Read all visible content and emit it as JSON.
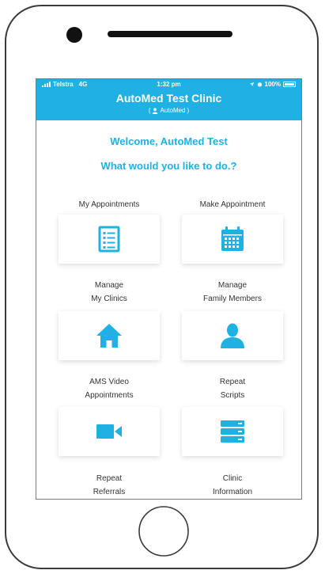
{
  "status_bar": {
    "carrier": "Telstra",
    "network": "4G",
    "time": "1:32 pm",
    "battery": "100%"
  },
  "header": {
    "title": "AutoMed Test Clinic",
    "user": "AutoMed"
  },
  "welcome": "Welcome, AutoMed Test",
  "question": "What would you like to do.?",
  "colors": {
    "accent": "#1fb1e4"
  },
  "menu": [
    {
      "label": "My Appointments",
      "icon": "list-icon"
    },
    {
      "label": "Make Appointment",
      "icon": "calendar-icon"
    },
    {
      "label": "Manage\nMy Clinics",
      "icon": "home-icon"
    },
    {
      "label": "Manage\nFamily Members",
      "icon": "person-icon"
    },
    {
      "label": "AMS Video\nAppointments",
      "icon": "video-camera-icon"
    },
    {
      "label": "Repeat\nScripts",
      "icon": "stack-icon"
    },
    {
      "label": "Repeat\nReferrals",
      "icon": "referral-icon"
    },
    {
      "label": "Clinic\nInformation",
      "icon": "info-icon"
    }
  ]
}
